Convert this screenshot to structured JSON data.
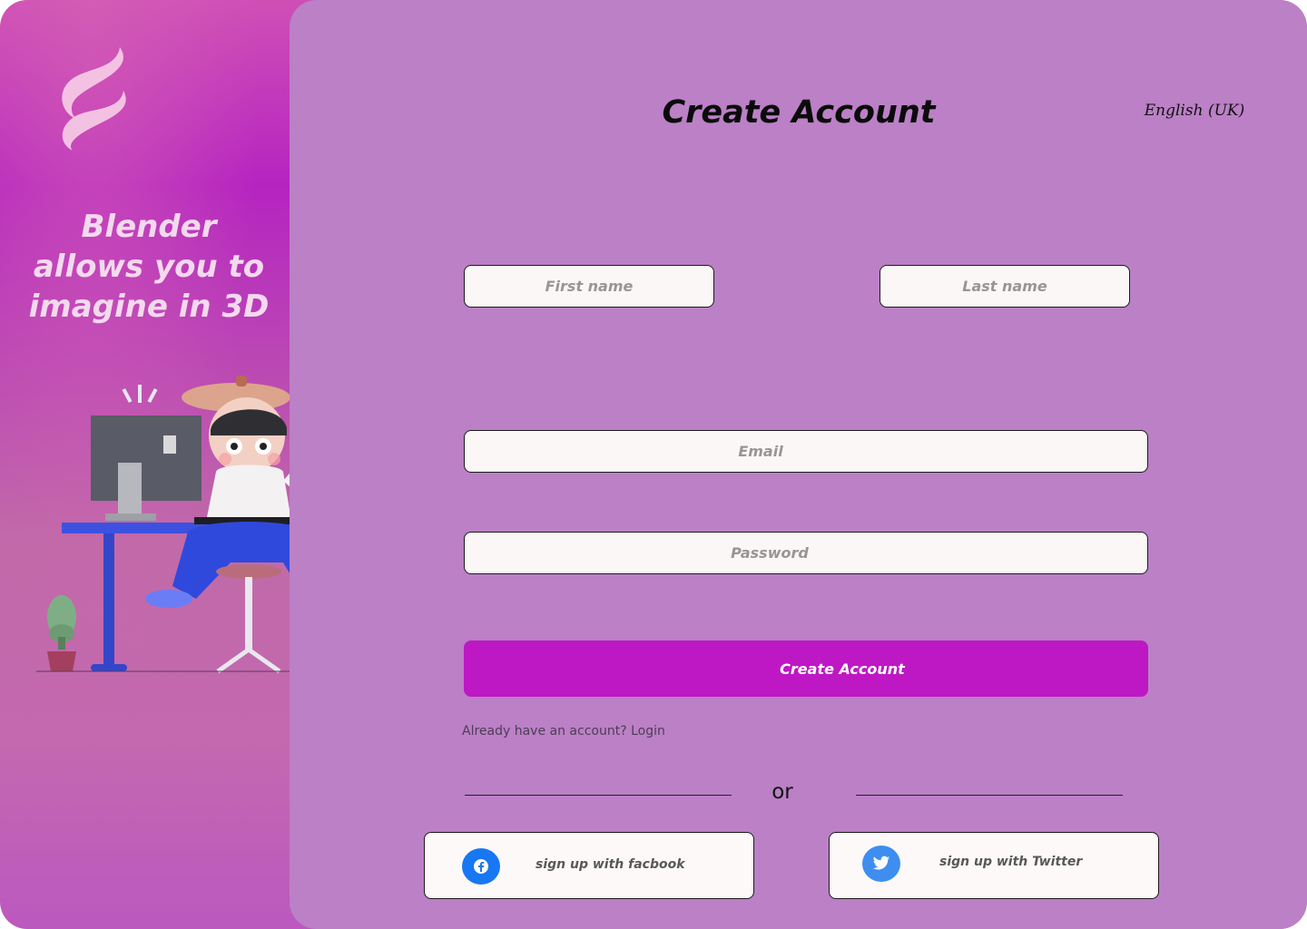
{
  "brand": {
    "logo_icon": "wave-logo-icon",
    "tagline": "Blender allows you to imagine in 3D",
    "illustration": "3d-character-at-desk-illustration"
  },
  "header": {
    "title": "Create Account",
    "language": "English (UK)"
  },
  "form": {
    "first_name": {
      "placeholder": "First name",
      "value": ""
    },
    "last_name": {
      "placeholder": "Last name",
      "value": ""
    },
    "email": {
      "placeholder": "Email",
      "value": ""
    },
    "password": {
      "placeholder": "Password",
      "value": ""
    },
    "submit_label": "Create Account",
    "login_prompt": "Already have an account?",
    "login_link": "Login"
  },
  "divider": {
    "label": "or"
  },
  "social": {
    "facebook": {
      "label": "sign up with facbook",
      "icon": "facebook-icon",
      "color": "#1877f2"
    },
    "twitter": {
      "label": "sign up with Twitter",
      "icon": "twitter-icon",
      "color": "#3d8ef0"
    }
  },
  "colors": {
    "accent": "#be18c4",
    "panel": "#bb80c6",
    "sidebar": "#b524c0"
  }
}
